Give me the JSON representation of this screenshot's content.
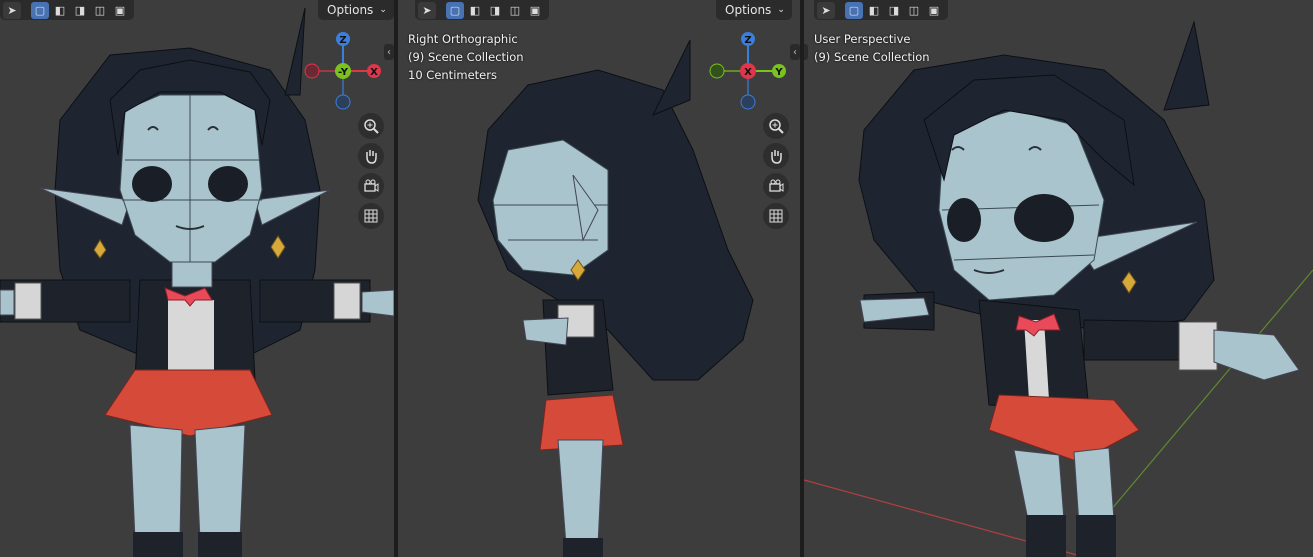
{
  "theme": {
    "viewport_bg": "#3d3d3d",
    "header_bg": "#2b2b2b",
    "accent": "#4772b3",
    "axis_x": "#e0354a",
    "axis_y": "#7ac21e",
    "axis_z": "#3a7fdc",
    "hair": "#1f2530",
    "skin": "#a9c4cc",
    "skirt": "#d64a3a",
    "bow": "#e84a5a",
    "earring": "#d6a93a"
  },
  "toolbar": {
    "select_icon": "cursor-select-icon",
    "mode_icons": [
      "select-box-icon",
      "extend-icon",
      "subtract-icon",
      "invert-icon",
      "intersect-icon"
    ],
    "options_label": "Options"
  },
  "viewports": [
    {
      "id": "front",
      "lines": [],
      "gizmo": {
        "center_label": "-Y",
        "right_label": "X",
        "up_label": "Z",
        "left_label": ""
      }
    },
    {
      "id": "right",
      "lines": [
        "Right Orthographic",
        "(9) Scene Collection",
        "10 Centimeters"
      ],
      "gizmo": {
        "center_label": "X",
        "right_label": "Y",
        "up_label": "Z",
        "left_label": ""
      }
    },
    {
      "id": "user",
      "lines": [
        "User Perspective",
        "(9) Scene Collection"
      ]
    }
  ],
  "nav_buttons": [
    "zoom-icon",
    "pan-hand-icon",
    "camera-view-icon",
    "ortho-grid-icon"
  ]
}
